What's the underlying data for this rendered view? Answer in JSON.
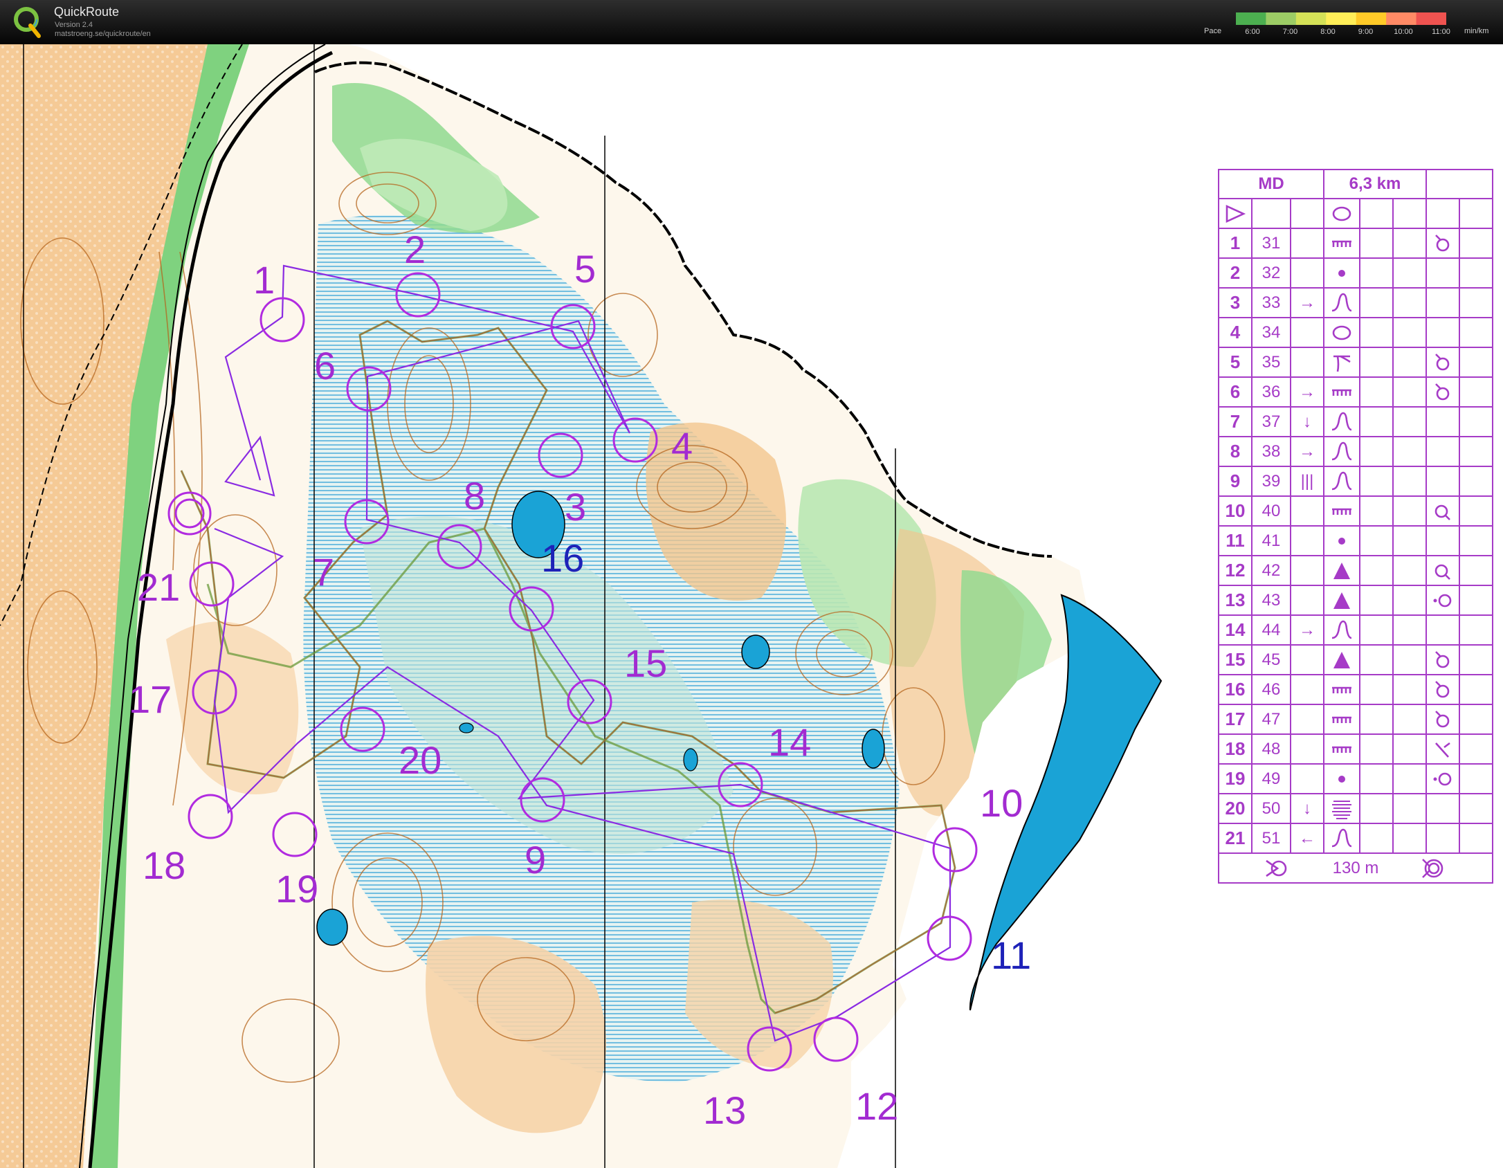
{
  "header": {
    "app_title": "QuickRoute",
    "version": "Version 2.4",
    "url": "matstroeng.se/quickroute/en",
    "pace_label": "Pace",
    "pace_ticks": [
      "6:00",
      "7:00",
      "8:00",
      "9:00",
      "10:00",
      "11:00"
    ],
    "pace_unit": "min/km",
    "pace_colors": [
      "#4caf50",
      "#9ccc65",
      "#d4e157",
      "#ffee58",
      "#ffca28",
      "#ff8a65",
      "#ef5350"
    ]
  },
  "map": {
    "water_color": "#1aa3d6",
    "course_color": "#b12be0",
    "control_labels": [
      "1",
      "2",
      "3",
      "4",
      "5",
      "6",
      "7",
      "8",
      "9",
      "10",
      "11",
      "12",
      "13",
      "14",
      "15",
      "16",
      "17",
      "18",
      "19",
      "20",
      "21"
    ]
  },
  "legend": {
    "class": "MD",
    "length": "6,3 km",
    "controls": [
      {
        "num": "1",
        "code": "31",
        "dir": "",
        "feature": "trench-icon",
        "extra": "knoll-icon"
      },
      {
        "num": "2",
        "code": "32",
        "dir": "",
        "feature": "dot-icon",
        "extra": ""
      },
      {
        "num": "3",
        "code": "33",
        "dir": "→",
        "feature": "spur-icon",
        "extra": ""
      },
      {
        "num": "4",
        "code": "34",
        "dir": "",
        "feature": "oval-icon",
        "extra": ""
      },
      {
        "num": "5",
        "code": "35",
        "dir": "",
        "feature": "gully-icon",
        "extra": "knoll-icon"
      },
      {
        "num": "6",
        "code": "36",
        "dir": "→",
        "feature": "trench-icon",
        "extra": "knoll-icon"
      },
      {
        "num": "7",
        "code": "37",
        "dir": "↓",
        "feature": "spur-icon",
        "extra": ""
      },
      {
        "num": "8",
        "code": "38",
        "dir": "→",
        "feature": "spur-icon",
        "extra": ""
      },
      {
        "num": "9",
        "code": "39",
        "dir": "|||",
        "feature": "spur-icon",
        "extra": ""
      },
      {
        "num": "10",
        "code": "40",
        "dir": "",
        "feature": "trench-icon",
        "extra": "side-icon"
      },
      {
        "num": "11",
        "code": "41",
        "dir": "",
        "feature": "dot-icon",
        "extra": ""
      },
      {
        "num": "12",
        "code": "42",
        "dir": "",
        "feature": "triangle-icon",
        "extra": "side-icon"
      },
      {
        "num": "13",
        "code": "43",
        "dir": "",
        "feature": "triangle-icon",
        "extra": "foot-icon"
      },
      {
        "num": "14",
        "code": "44",
        "dir": "→",
        "feature": "spur-icon",
        "extra": ""
      },
      {
        "num": "15",
        "code": "45",
        "dir": "",
        "feature": "triangle-icon",
        "extra": "knoll-icon"
      },
      {
        "num": "16",
        "code": "46",
        "dir": "",
        "feature": "trench-icon",
        "extra": "knoll-icon"
      },
      {
        "num": "17",
        "code": "47",
        "dir": "",
        "feature": "trench-icon",
        "extra": "knoll-icon"
      },
      {
        "num": "18",
        "code": "48",
        "dir": "",
        "feature": "trench-icon",
        "extra": "slash-icon"
      },
      {
        "num": "19",
        "code": "49",
        "dir": "",
        "feature": "dot-icon",
        "extra": "foot-icon"
      },
      {
        "num": "20",
        "code": "50",
        "dir": "↓",
        "feature": "lines-icon",
        "extra": ""
      },
      {
        "num": "21",
        "code": "51",
        "dir": "←",
        "feature": "spur-icon",
        "extra": ""
      }
    ],
    "finish_distance": "130 m"
  }
}
